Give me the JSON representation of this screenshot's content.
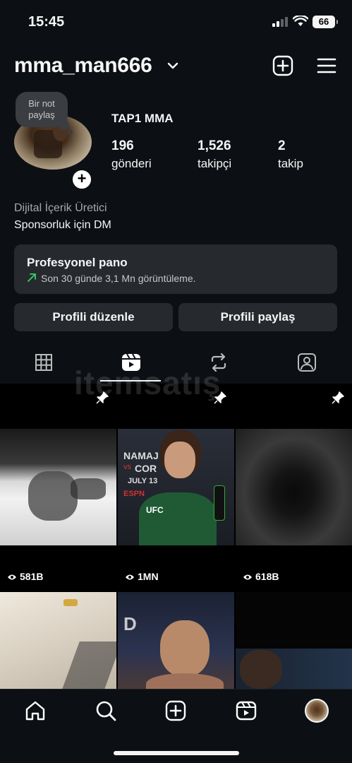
{
  "status_bar": {
    "time": "15:45",
    "battery": "66"
  },
  "header": {
    "username": "mma_man666"
  },
  "profile": {
    "note": "Bir not paylaş",
    "display_name": "TAP1 MMA",
    "posts_count": "196",
    "posts_label": "gönderi",
    "followers_count": "1,526",
    "followers_label": "takipçi",
    "following_count": "2",
    "following_label": "takip",
    "category": "Dijital İçerik Üretici",
    "bio": "Sponsorluk için DM"
  },
  "dashboard": {
    "title": "Profesyonel pano",
    "subtitle": "Son 30 günde 3,1 Mn görüntüleme."
  },
  "buttons": {
    "edit_profile": "Profili düzenle",
    "share_profile": "Profili paylaş"
  },
  "watermark": "itemsatış",
  "grid": {
    "items": [
      {
        "views": "581B",
        "pinned": true
      },
      {
        "views": "1MN",
        "pinned": true
      },
      {
        "views": "618B",
        "pinned": true
      },
      {
        "views": ""
      },
      {
        "views": ""
      },
      {
        "views": ""
      }
    ],
    "overlay_text": {
      "namaj": "NAMAJ",
      "cor": "COR",
      "vs": "vs",
      "date": "JULY 13",
      "espn": "ESPN",
      "ufc": "UFC"
    }
  },
  "icons": {
    "status": [
      "signal-icon",
      "wifi-icon",
      "battery-icon"
    ],
    "header": [
      "chevron-down-icon",
      "new-post-icon",
      "menu-icon"
    ],
    "tabs": [
      "grid-icon",
      "reels-icon",
      "reposts-icon",
      "tagged-icon"
    ],
    "nav": [
      "home-icon",
      "search-icon",
      "create-icon",
      "reels-icon",
      "profile-avatar"
    ]
  },
  "colors": {
    "background": "#0c1014",
    "card": "#262a2f",
    "accent_green": "#36d06a",
    "text": "#f5f5f5",
    "muted": "#a8a8a8"
  }
}
